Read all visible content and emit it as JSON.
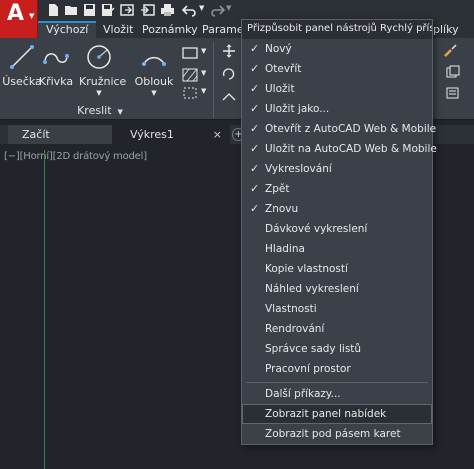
{
  "app": {
    "logo_letter": "A"
  },
  "ribbon_tabs": [
    {
      "label": "Výchozí",
      "active": true
    },
    {
      "label": "Vložit",
      "active": false
    },
    {
      "label": "Poznámky",
      "active": false
    },
    {
      "label": "Parametr",
      "active": false
    },
    {
      "label": "plíky",
      "active": false
    }
  ],
  "draw_panel": {
    "tools": [
      {
        "label": "Úsečka",
        "icon": "line-icon"
      },
      {
        "label": "Křivka",
        "icon": "polyline-icon"
      },
      {
        "label": "Kružnice",
        "icon": "circle-icon"
      },
      {
        "label": "Oblouk",
        "icon": "arc-icon"
      }
    ],
    "title": "Kreslit"
  },
  "doc_tabs": [
    {
      "label": "Začít"
    },
    {
      "label": "Výkres1",
      "close": "×"
    }
  ],
  "viewport": {
    "label": "[−][Horní][2D drátový model]"
  },
  "menu": {
    "header": "Přizpůsobit panel nástrojů Rychlý přístup",
    "check_glyph": "✓",
    "items": [
      {
        "label": "Nový",
        "checked": true
      },
      {
        "label": "Otevřít",
        "checked": true
      },
      {
        "label": "Uložit",
        "checked": true
      },
      {
        "label": "Uložit jako...",
        "checked": true
      },
      {
        "label": "Otevřít z AutoCAD Web & Mobile",
        "checked": true
      },
      {
        "label": "Uložit na AutoCAD Web & Mobile",
        "checked": true
      },
      {
        "label": "Vykreslování",
        "checked": true
      },
      {
        "label": "Zpět",
        "checked": true
      },
      {
        "label": "Znovu",
        "checked": true
      },
      {
        "label": "Dávkové vykreslení",
        "checked": false
      },
      {
        "label": "Hladina",
        "checked": false
      },
      {
        "label": "Kopie vlastností",
        "checked": false
      },
      {
        "label": "Náhled vykreslení",
        "checked": false
      },
      {
        "label": "Vlastnosti",
        "checked": false
      },
      {
        "label": "Rendrování",
        "checked": false
      },
      {
        "label": "Správce sady listů",
        "checked": false
      },
      {
        "label": "Pracovní prostor",
        "checked": false
      }
    ],
    "more": "Další příkazy...",
    "show_menubar": "Zobrazit panel nabídek",
    "show_below": "Zobrazit pod pásem karet"
  },
  "colors": {
    "app_red": "#c81e1e",
    "accent_blue": "#2c8ecf",
    "canvas": "#21252b"
  }
}
